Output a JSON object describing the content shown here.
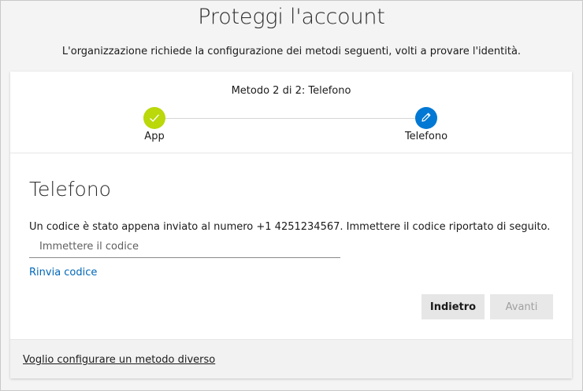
{
  "page": {
    "title": "Proteggi l'account",
    "subtitle": "L'organizzazione richiede la configurazione dei metodi seguenti, volti a provare l'identità."
  },
  "progress": {
    "caption": "Metodo 2 di 2: Telefono",
    "current_step": 2,
    "total_steps": 2,
    "steps": [
      {
        "label": "App",
        "state": "completed",
        "icon": "check-icon"
      },
      {
        "label": "Telefono",
        "state": "current",
        "icon": "pencil-icon"
      }
    ]
  },
  "phone_step": {
    "heading": "Telefono",
    "message": "Un codice è stato appena inviato al numero +1 4251234567. Immettere il codice riportato di seguito.",
    "code_placeholder": "Immettere il codice",
    "code_value": "",
    "resend_label": "Rinvia codice"
  },
  "actions": {
    "back_label": "Indietro",
    "next_label": "Avanti",
    "next_enabled": false
  },
  "footer": {
    "alternate_method_label": "Voglio configurare un metodo diverso"
  },
  "colors": {
    "completed": "#bad80a",
    "current": "#0078d4",
    "link": "#0067b8"
  }
}
